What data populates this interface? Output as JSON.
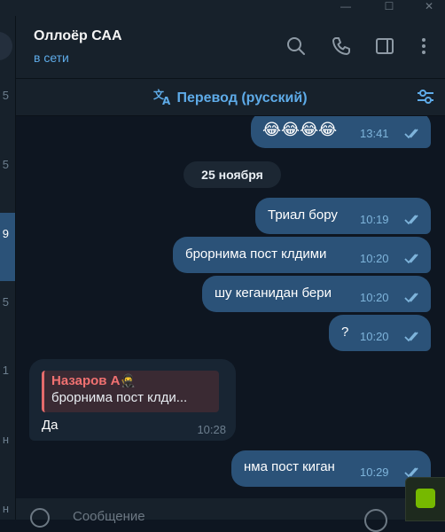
{
  "window": {
    "controls": [
      "—",
      "☐",
      "✕"
    ]
  },
  "chat_list_edge": {
    "numbers": [
      "5",
      "5",
      "9",
      "5",
      "1",
      "н",
      "н"
    ]
  },
  "header": {
    "title": "Оллоёр САА",
    "status": "в сети"
  },
  "translate_bar": {
    "label": "Перевод (русский)"
  },
  "date_separator": "25 ноября",
  "messages_out_top": {
    "text": "😂😂😂😂",
    "time": "13:41"
  },
  "messages_out": [
    {
      "text": "Триал бору",
      "time": "10:19"
    },
    {
      "text": "брорнима пост клдими",
      "time": "10:20"
    },
    {
      "text": "шу кеганидан бери",
      "time": "10:20"
    },
    {
      "text": "?",
      "time": "10:20"
    }
  ],
  "message_in": {
    "reply_name": "Назаров А",
    "reply_name_emoji": "🥷",
    "reply_text": "брорнима пост клди...",
    "text": "Да",
    "time": "10:28"
  },
  "message_last": {
    "text": "нма пост киган",
    "time": "10:29"
  },
  "input": {
    "placeholder": "Сообщение"
  },
  "colors": {
    "bg": "#0e1621",
    "panel": "#17212b",
    "bubble_out": "#2b5278",
    "bubble_in": "#182533",
    "accent": "#5eabe8",
    "reply_name": "#f07171"
  }
}
